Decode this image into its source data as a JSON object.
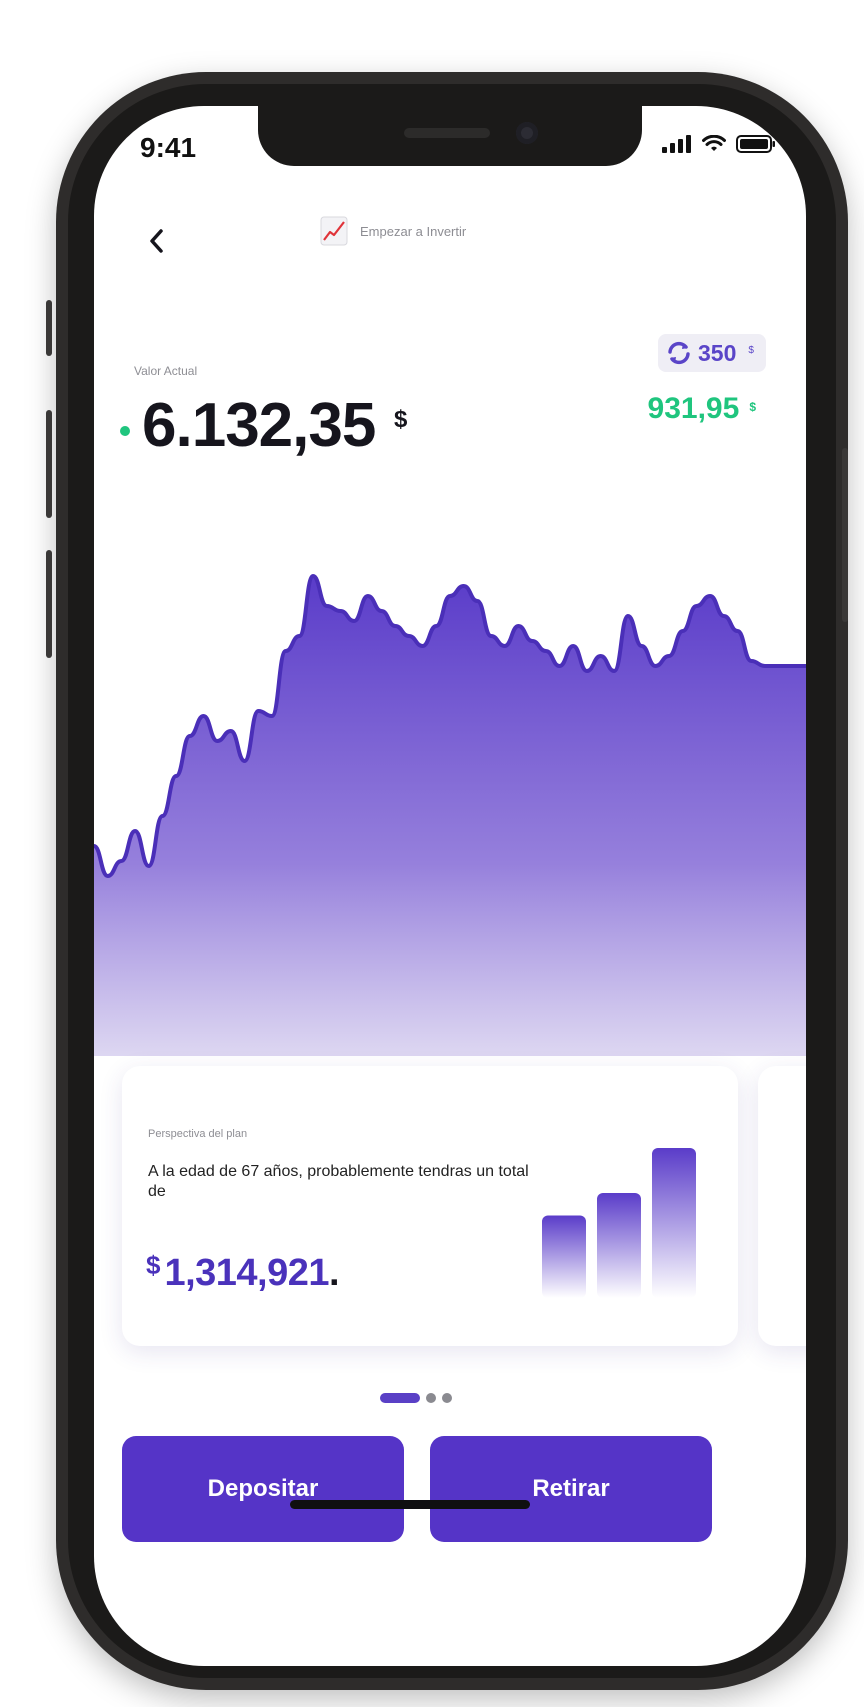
{
  "status_bar": {
    "time": "9:41"
  },
  "header": {
    "title": "Empezar a Invertir",
    "icon": "chart-up-icon"
  },
  "portfolio": {
    "label": "Valor Actual",
    "value": "6.132,35",
    "currency": "$",
    "recurring_amount": "350",
    "recurring_currency": "$",
    "gain": "931,95",
    "gain_currency": "$"
  },
  "chart_data": {
    "type": "area",
    "x": [
      0,
      1,
      2,
      3,
      4,
      5,
      6,
      7,
      8,
      9,
      10,
      11,
      12,
      13,
      14,
      15,
      16,
      17,
      18,
      19,
      20,
      21,
      22,
      23,
      24,
      25,
      26,
      27,
      28,
      29,
      30,
      31,
      32,
      33,
      34,
      35,
      36,
      37,
      38,
      39,
      40,
      41,
      42,
      43,
      44,
      45,
      46,
      47,
      48,
      49,
      50,
      51,
      52
    ],
    "values": [
      34,
      28,
      31,
      37,
      30,
      40,
      48,
      56,
      60,
      55,
      57,
      51,
      61,
      60,
      73,
      76,
      88,
      82,
      81,
      79,
      84,
      81,
      78,
      76,
      74,
      78,
      84,
      86,
      83,
      76,
      74,
      78,
      75,
      73,
      70,
      74,
      69,
      72,
      69,
      80,
      74,
      70,
      72,
      77,
      82,
      84,
      80,
      77,
      71,
      70,
      70,
      70,
      70
    ],
    "color": "#5a3fcb",
    "grid": false,
    "axes_visible": false
  },
  "plan_card": {
    "label": "Perspectiva del plan",
    "text": "A la edad de 67 años, probablemente tendras un total de",
    "amount_currency": "$",
    "amount": "1,314,921",
    "amount_suffix": ".",
    "bars": [
      0.55,
      0.7,
      1.0
    ]
  },
  "pagination": {
    "active_index": 0,
    "count": 3
  },
  "actions": {
    "deposit": "Depositar",
    "withdraw": "Retirar"
  },
  "colors": {
    "accent": "#5534c7",
    "gain": "#1fc57e",
    "text": "#16151d"
  }
}
